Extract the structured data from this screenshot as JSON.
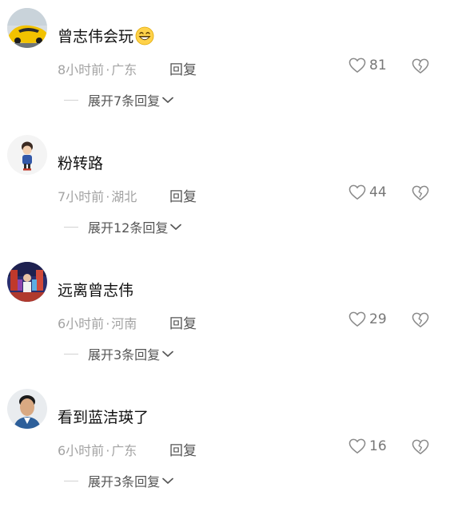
{
  "comments": [
    {
      "text": "曾志伟会玩",
      "time": "8小时前",
      "separator": "·",
      "location": "广东",
      "reply_label": "回复",
      "likes": "81",
      "expand_label": "展开7条回复"
    },
    {
      "text": "粉转路",
      "time": "7小时前",
      "separator": "·",
      "location": "湖北",
      "reply_label": "回复",
      "likes": "44",
      "expand_label": "展开12条回复"
    },
    {
      "text": "远离曾志伟",
      "time": "6小时前",
      "separator": "·",
      "location": "河南",
      "reply_label": "回复",
      "likes": "29",
      "expand_label": "展开3条回复"
    },
    {
      "text": "看到蓝洁瑛了",
      "time": "6小时前",
      "separator": "·",
      "location": "广东",
      "reply_label": "回复",
      "likes": "16",
      "expand_label": "展开3条回复"
    }
  ],
  "icons": {
    "like": "heart-outline-icon",
    "dislike": "broken-heart-icon",
    "expand": "chevron-down-icon",
    "emoji": "grinning-face-emoji"
  },
  "colors": {
    "text_primary": "#111111",
    "text_meta": "#a3a3a3",
    "text_action": "#555555",
    "icon": "#8a8a8a"
  }
}
